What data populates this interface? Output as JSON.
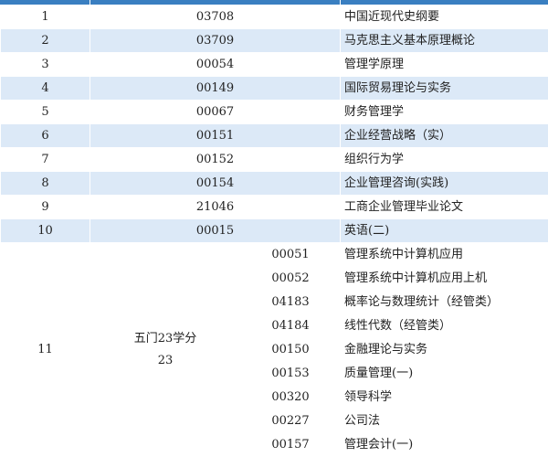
{
  "rows": [
    {
      "seq": "1",
      "code": "03708",
      "name": "中国近现代史纲要"
    },
    {
      "seq": "2",
      "code": "03709",
      "name": "马克思主义基本原理概论"
    },
    {
      "seq": "3",
      "code": "00054",
      "name": "管理学原理"
    },
    {
      "seq": "4",
      "code": "00149",
      "name": "国际贸易理论与实务"
    },
    {
      "seq": "5",
      "code": "00067",
      "name": "财务管理学"
    },
    {
      "seq": "6",
      "code": "00151",
      "name": "企业经营战略（实）"
    },
    {
      "seq": "7",
      "code": "00152",
      "name": "组织行为学"
    },
    {
      "seq": "8",
      "code": "00154",
      "name": "企业管理咨询(实践)"
    },
    {
      "seq": "9",
      "code": "21046",
      "name": "工商企业管理毕业论文"
    },
    {
      "seq": "10",
      "code": "00015",
      "name": "英语(二)"
    }
  ],
  "elective_group": {
    "seq": "11",
    "label_line1": "五门23学分",
    "label_line2": "23",
    "courses": [
      {
        "code": "00051",
        "name": "管理系统中计算机应用"
      },
      {
        "code": "00052",
        "name": "管理系统中计算机应用上机"
      },
      {
        "code": "04183",
        "name": "概率论与数理统计（经管类）"
      },
      {
        "code": "04184",
        "name": "线性代数（经管类）"
      },
      {
        "code": "00150",
        "name": "金融理论与实务"
      },
      {
        "code": "00153",
        "name": "质量管理(一)"
      },
      {
        "code": "00320",
        "name": "领导科学"
      },
      {
        "code": "00227",
        "name": "公司法"
      },
      {
        "code": "00157",
        "name": "管理会计(一)"
      }
    ]
  },
  "colors": {
    "header_strip": "#3a7fc1",
    "row_blue": "#dce9f7",
    "row_white": "#ffffff"
  }
}
